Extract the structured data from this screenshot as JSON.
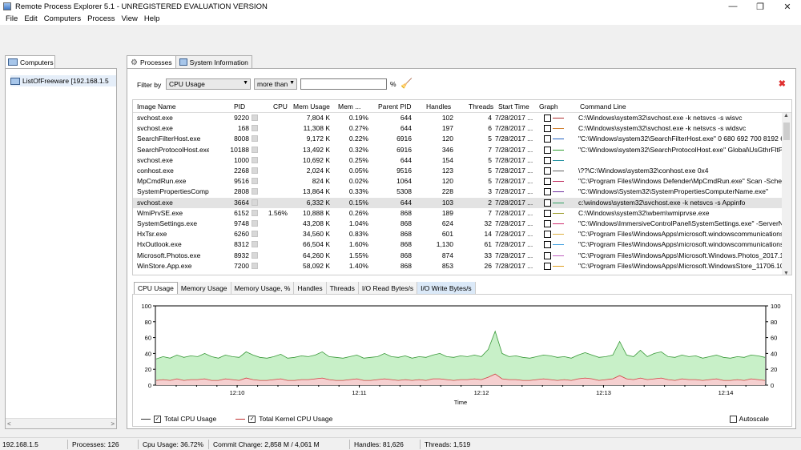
{
  "window": {
    "title": "Remote Process Explorer 5.1 - UNREGISTERED EVALUATION VERSION",
    "minimize": "—",
    "maximize": "❐",
    "close": "✕"
  },
  "menu": [
    "File",
    "Edit",
    "Computers",
    "Process",
    "View",
    "Help"
  ],
  "left": {
    "tab_label": "Computers",
    "tree_item": "ListOfFreeware [192.168.1.5",
    "scroll_left": "<",
    "scroll_right": ">"
  },
  "tabs": {
    "processes": "Processes",
    "system_info": "System Information"
  },
  "filter": {
    "label": "Filter by",
    "field": "CPU Usage",
    "operator": "more than",
    "value": "",
    "unit": "%"
  },
  "columns": [
    "Image Name",
    "PID",
    "CPU",
    "Mem Usage",
    "Mem ...",
    "Parent PID",
    "Handles",
    "Threads",
    "Start Time",
    "Graph",
    "Command Line"
  ],
  "rows": [
    {
      "name": "svchost.exe",
      "pid": "9220",
      "cpu": "",
      "mem": "7,804 K",
      "memp": "0.19%",
      "ppid": "644",
      "handles": "102",
      "threads": "4",
      "start": "7/28/2017 ...",
      "color": "#b03030",
      "cmd": "C:\\Windows\\system32\\svchost.exe -k netsvcs -s wisvc"
    },
    {
      "name": "svchost.exe",
      "pid": "168",
      "cpu": "",
      "mem": "11,308 K",
      "memp": "0.27%",
      "ppid": "644",
      "handles": "197",
      "threads": "6",
      "start": "7/28/2017 ...",
      "color": "#d08030",
      "cmd": "C:\\Windows\\system32\\svchost.exe -k netsvcs -s widsvc"
    },
    {
      "name": "SearchFilterHost.exe",
      "pid": "8008",
      "cpu": "",
      "mem": "9,172 K",
      "memp": "0.22%",
      "ppid": "6916",
      "handles": "120",
      "threads": "5",
      "start": "7/28/2017 ...",
      "color": "#2060c0",
      "cmd": "\"C:\\Windows\\system32\\SearchFilterHost.exe\" 0 680 692 700 8192 696"
    },
    {
      "name": "SearchProtocolHost.exe",
      "pid": "10188",
      "cpu": "",
      "mem": "13,492 K",
      "memp": "0.32%",
      "ppid": "6916",
      "handles": "346",
      "threads": "7",
      "start": "7/28/2017 ...",
      "color": "#30a030",
      "cmd": "\"C:\\Windows\\system32\\SearchProtocolHost.exe\" Global\\UsGthrFltP..."
    },
    {
      "name": "svchost.exe",
      "pid": "1000",
      "cpu": "",
      "mem": "10,692 K",
      "memp": "0.25%",
      "ppid": "644",
      "handles": "154",
      "threads": "5",
      "start": "7/28/2017 ...",
      "color": "#2090a0",
      "cmd": ""
    },
    {
      "name": "conhost.exe",
      "pid": "2268",
      "cpu": "",
      "mem": "2,024 K",
      "memp": "0.05%",
      "ppid": "9516",
      "handles": "123",
      "threads": "5",
      "start": "7/28/2017 ...",
      "color": "#606060",
      "cmd": "\\??\\C:\\Windows\\system32\\conhost.exe 0x4"
    },
    {
      "name": "MpCmdRun.exe",
      "pid": "9516",
      "cpu": "",
      "mem": "824 K",
      "memp": "0.02%",
      "ppid": "1064",
      "handles": "120",
      "threads": "5",
      "start": "7/28/2017 ...",
      "color": "#c03060",
      "cmd": "\"C:\\Program Files\\Windows Defender\\MpCmdRun.exe\" Scan -Schedu..."
    },
    {
      "name": "SystemPropertiesComp...",
      "pid": "2808",
      "cpu": "",
      "mem": "13,864 K",
      "memp": "0.33%",
      "ppid": "5308",
      "handles": "228",
      "threads": "3",
      "start": "7/28/2017 ...",
      "color": "#7030a0",
      "cmd": "\"C:\\Windows\\System32\\SystemPropertiesComputerName.exe\""
    },
    {
      "name": "svchost.exe",
      "pid": "3664",
      "cpu": "",
      "mem": "6,332 K",
      "memp": "0.15%",
      "ppid": "644",
      "handles": "103",
      "threads": "2",
      "start": "7/28/2017 ...",
      "color": "#30a060",
      "cmd": "c:\\windows\\system32\\svchost.exe -k netsvcs -s Appinfo",
      "selected": true
    },
    {
      "name": "WmiPrvSE.exe",
      "pid": "6152",
      "cpu": "1.56%",
      "mem": "10,888 K",
      "memp": "0.26%",
      "ppid": "868",
      "handles": "189",
      "threads": "7",
      "start": "7/28/2017 ...",
      "color": "#a0a030",
      "cmd": "C:\\Windows\\system32\\wbem\\wmiprvse.exe"
    },
    {
      "name": "SystemSettings.exe",
      "pid": "9748",
      "cpu": "",
      "mem": "43,208 K",
      "memp": "1.04%",
      "ppid": "868",
      "handles": "624",
      "threads": "32",
      "start": "7/28/2017 ...",
      "color": "#d03070",
      "cmd": "\"C:\\Windows\\ImmersiveControlPanel\\SystemSettings.exe\" -ServerNam..."
    },
    {
      "name": "HxTsr.exe",
      "pid": "6260",
      "cpu": "",
      "mem": "34,560 K",
      "memp": "0.83%",
      "ppid": "868",
      "handles": "601",
      "threads": "14",
      "start": "7/28/2017 ...",
      "color": "#e0b040",
      "cmd": "\"C:\\Program Files\\WindowsApps\\microsoft.windowscommunicationsap..."
    },
    {
      "name": "HxOutlook.exe",
      "pid": "8312",
      "cpu": "",
      "mem": "66,504 K",
      "memp": "1.60%",
      "ppid": "868",
      "handles": "1,130",
      "threads": "61",
      "start": "7/28/2017 ...",
      "color": "#40a0e0",
      "cmd": "\"C:\\Program Files\\WindowsApps\\microsoft.windowscommunicationsap..."
    },
    {
      "name": "Microsoft.Photos.exe",
      "pid": "8932",
      "cpu": "",
      "mem": "64,260 K",
      "memp": "1.55%",
      "ppid": "868",
      "handles": "874",
      "threads": "33",
      "start": "7/28/2017 ...",
      "color": "#c060c0",
      "cmd": "\"C:\\Program Files\\WindowsApps\\Microsoft.Windows.Photos_2017.18..."
    },
    {
      "name": "WinStore.App.exe",
      "pid": "7200",
      "cpu": "",
      "mem": "58,092 K",
      "memp": "1.40%",
      "ppid": "868",
      "handles": "853",
      "threads": "26",
      "start": "7/28/2017 ...",
      "color": "#e0a020",
      "cmd": "\"C:\\Program Files\\WindowsApps\\Microsoft.WindowsStore_11706.100..."
    }
  ],
  "chart_tabs": [
    "CPU Usage",
    "Memory Usage",
    "Memory Usage, %",
    "Handles",
    "Threads",
    "I/O Read Bytes/s",
    "I/O Write Bytes/s"
  ],
  "chart": {
    "y_ticks": [
      "100",
      "80",
      "60",
      "40",
      "20",
      "0"
    ],
    "x_ticks": [
      "12:10",
      "12:11",
      "12:12",
      "12:13",
      "12:14"
    ],
    "xlabel": "Time",
    "total_color": "#3a9a3a",
    "total_fill": "#c8f0c8",
    "kernel_color": "#d04040",
    "kernel_fill": "#f5d0d0"
  },
  "chart_data": {
    "type": "area",
    "x": [
      "12:10",
      "12:11",
      "12:12",
      "12:13",
      "12:14"
    ],
    "ylim": [
      0,
      100
    ],
    "xlabel": "Time",
    "series": [
      {
        "name": "Total CPU Usage",
        "values": [
          33,
          36,
          34,
          38,
          35,
          37,
          36,
          40,
          36,
          34,
          38,
          36,
          35,
          42,
          38,
          35,
          34,
          36,
          39,
          34,
          35,
          37,
          36,
          38,
          42,
          36,
          35,
          34,
          36,
          38,
          34,
          35,
          36,
          40,
          36,
          35,
          37,
          34,
          36,
          35,
          38,
          40,
          36,
          35,
          37,
          36,
          38,
          36,
          45,
          68,
          40,
          36,
          37,
          35,
          34,
          36,
          38,
          37,
          35,
          36,
          34,
          38,
          41,
          38,
          35,
          36,
          38,
          55,
          38,
          36,
          44,
          36,
          40,
          42,
          36,
          35,
          38,
          36,
          37,
          34,
          36,
          38,
          35,
          34,
          36,
          35,
          38,
          37,
          35
        ]
      },
      {
        "name": "Total Kernel CPU Usage",
        "values": [
          6,
          7,
          6,
          8,
          6,
          7,
          7,
          8,
          6,
          6,
          8,
          7,
          6,
          9,
          7,
          6,
          6,
          7,
          8,
          6,
          6,
          7,
          7,
          8,
          9,
          7,
          6,
          6,
          7,
          8,
          6,
          6,
          7,
          8,
          7,
          6,
          7,
          6,
          7,
          6,
          8,
          8,
          7,
          6,
          7,
          7,
          8,
          7,
          10,
          14,
          8,
          7,
          7,
          6,
          6,
          7,
          8,
          7,
          6,
          7,
          6,
          8,
          9,
          8,
          6,
          7,
          8,
          12,
          8,
          7,
          9,
          7,
          8,
          9,
          7,
          6,
          8,
          7,
          7,
          6,
          7,
          8,
          6,
          6,
          7,
          6,
          8,
          7,
          6
        ]
      }
    ]
  },
  "legend": {
    "total": "Total CPU Usage",
    "kernel": "Total Kernel CPU Usage",
    "autoscale": "Autoscale"
  },
  "status": {
    "ip": "192.168.1.5",
    "processes": "Processes: 126",
    "cpu": "Cpu Usage: 36.72%",
    "commit": "Commit Charge: 2,858 M / 4,061 M",
    "handles": "Handles: 81,626",
    "threads": "Threads: 1,519"
  }
}
